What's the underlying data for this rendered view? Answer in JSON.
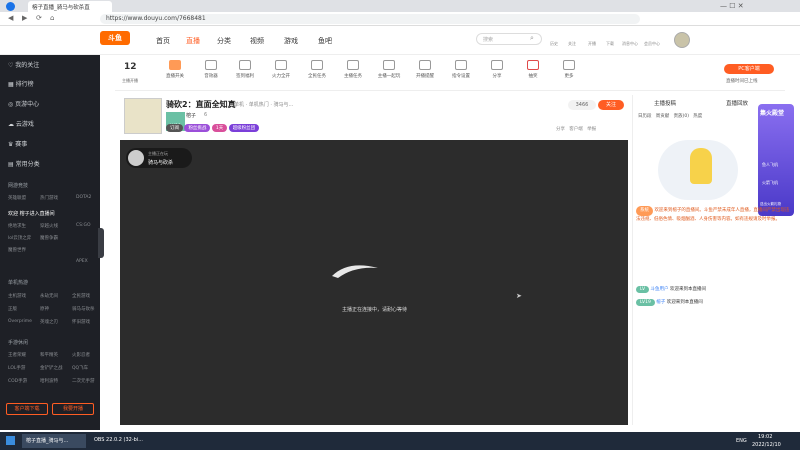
{
  "browser": {
    "tab_title": "榕子直播_骑马与砍杀直",
    "url": "https://www.douyu.com/7668481"
  },
  "site": {
    "logo": "斗鱼",
    "nav": [
      "首页",
      "直播",
      "分类",
      "视频",
      "游戏",
      "鱼吧"
    ],
    "search_placeholder": "搜索",
    "user_icons": [
      "历史",
      "关注",
      "开播",
      "下载",
      "消息中心",
      "会员中心"
    ]
  },
  "categories": {
    "count_num": "12",
    "count_label": "主播开播",
    "items": [
      "直播开关",
      "音效器",
      "签到福利",
      "火力全开",
      "全民任务",
      "主播任务",
      "主播一起玩",
      "开播提醒",
      "指令设置",
      "分享",
      "抽奖",
      "更多"
    ],
    "promo_btn": "PC客户端",
    "promo_sub": "直播时间已上线"
  },
  "room": {
    "title": "骑砍2：直面全知真",
    "sub": "单机 · 单机热门 · 骑马与...",
    "host": "榕子",
    "level": "LV19",
    "fans": "6",
    "follow_count": "3466",
    "follow_btn": "关注",
    "badges": [
      "订阅",
      "粉丝挑战",
      "1天",
      "超级粉丝团"
    ],
    "actions": [
      "分享",
      "客户端",
      "举报"
    ]
  },
  "video": {
    "avatar_caption": "主播正在玩",
    "game_tag": "骑马与砍杀",
    "status_text": "主播正在连接中，请耐心等待"
  },
  "right_panel": {
    "tabs": [
      "主播投稿",
      "直播回放"
    ],
    "sub_tabs": [
      "日历段",
      "周贡献",
      "贵族(0)",
      "热度"
    ],
    "chat_lines": [
      {
        "prefix": "系统",
        "text": "欢迎来到榕子的直播间。斗鱼严禁未成年人直播，直播间严禁出现违法违规、低俗色情、吸烟酗酒、人身伤害等内容。如有违规请及时举报。"
      },
      {
        "prefix": "LV",
        "name": "斗鱼用户",
        "text": "欢迎来到本直播间"
      },
      {
        "prefix": "LV19",
        "name": "榕子",
        "text": "欢迎来到本直播间"
      }
    ],
    "promo_title": "集火殿堂",
    "promo_items": [
      "鱼人飞机",
      "火箭飞机"
    ],
    "promo_foot": "送出火箭礼物"
  },
  "sidebar": {
    "items": [
      {
        "label": "我的关注",
        "icon": "heart-icon"
      },
      {
        "label": "排行榜",
        "icon": "rank-icon"
      },
      {
        "label": "页游中心",
        "icon": "gamepad-icon"
      },
      {
        "label": "云游戏",
        "icon": "cloud-icon"
      },
      {
        "label": "赛事",
        "icon": "trophy-icon"
      },
      {
        "label": "常用分类",
        "icon": "folder-icon"
      }
    ],
    "sections": [
      {
        "title": "网游竞技",
        "games": [
          "英雄联盟",
          "热门游戏",
          "DOTA2",
          "绝地求生",
          "穿越火线",
          "CS:GO",
          "lol云顶之弈",
          "魔兽争霸",
          "魔兽世界",
          "APEX"
        ]
      },
      {
        "title": "单机热游",
        "games": [
          "主机游戏",
          "永劫无间",
          "全民游戏",
          "正版",
          "原神",
          "骑马与砍杀",
          "Overprime",
          "英魂之刃",
          "怀旧游戏"
        ]
      },
      {
        "title": "手游休闲",
        "games": [
          "王者荣耀",
          "和平精英",
          "火影忍者",
          "LOL手游",
          "金铲铲之战",
          "QQ飞车",
          "COD手游",
          "哈利波特",
          "二次元手游"
        ]
      }
    ],
    "welcome": "欢迎 榕子进入直播间",
    "btn_left": "客户端下载",
    "btn_right": "我要开播"
  },
  "taskbar": {
    "items": [
      "榕子直播_骑马与...",
      "OBS 22.0.2 (32-bi..."
    ],
    "lang": "ENG",
    "time": "19:02",
    "date": "2022/12/10"
  },
  "colors": {
    "brand": "#ff5d23",
    "sidebar": "#1e2026",
    "video": "#2c2c2c",
    "taskbar": "#1f2a3a"
  }
}
